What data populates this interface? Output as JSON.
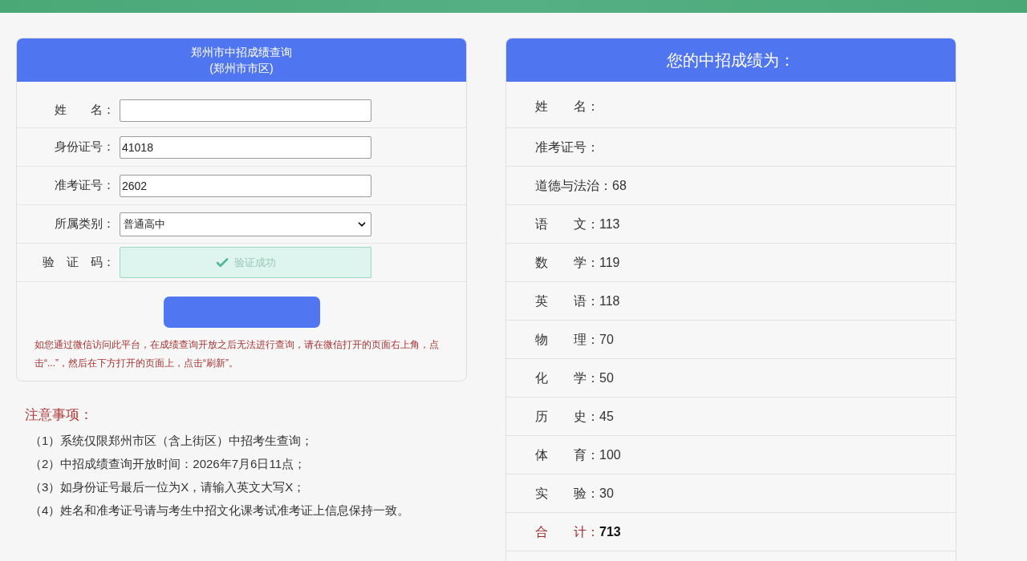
{
  "query_card": {
    "title": "郑州市中招成绩查询",
    "subtitle": "(郑州市市区)",
    "fields": [
      {
        "kind": "input",
        "label": "姓　　名："
      },
      {
        "kind": "input",
        "label": "身份证号：",
        "value": "41018"
      },
      {
        "kind": "input",
        "label": "准考证号：",
        "value": "2602"
      },
      {
        "kind": "select",
        "label": "所属类别：",
        "value": "普通高中"
      },
      {
        "kind": "captcha",
        "label": "验　证　码：",
        "status_text": "验证成功",
        "verified": true
      }
    ],
    "notice": "如您通过微信访问此平台，在成绩查询开放之后无法进行查询，请在微信打开的页面右上角，点击“...”，然后在下方打开的页面上，点击“刷新”。"
  },
  "notes": {
    "title": "注意事项：",
    "items": [
      "（1）系统仅限郑州市区（含上街区）中招考生查询；",
      "（2）中招成绩查询开放时间：2026年7月6日11点；",
      "（3）如身份证号最后一位为X，请输入英文大写X；",
      "（4）姓名和准考证号请与考生中招文化课考试准考证上信息保持一致。"
    ]
  },
  "result_card": {
    "title": "您的中招成绩为：",
    "rows": [
      {
        "kind": "score",
        "label": "姓　　名："
      },
      {
        "kind": "score",
        "label": "准考证号："
      },
      {
        "kind": "score",
        "label": "道德与法治：",
        "value": "68"
      },
      {
        "kind": "score",
        "label": "语　　文：",
        "value": "113"
      },
      {
        "kind": "score",
        "label": "数　　学：",
        "value": "119"
      },
      {
        "kind": "score",
        "label": "英　　语：",
        "value": "118"
      },
      {
        "kind": "score",
        "label": "物　　理：",
        "value": "70"
      },
      {
        "kind": "score",
        "label": "化　　学：",
        "value": "50"
      },
      {
        "kind": "score",
        "label": "历　　史：",
        "value": "45"
      },
      {
        "kind": "score",
        "label": "体　　育：",
        "value": "100"
      },
      {
        "kind": "score",
        "label": "实　　验：",
        "value": "30"
      },
      {
        "kind": "total",
        "label": "合　　计：",
        "value": "713"
      }
    ]
  }
}
